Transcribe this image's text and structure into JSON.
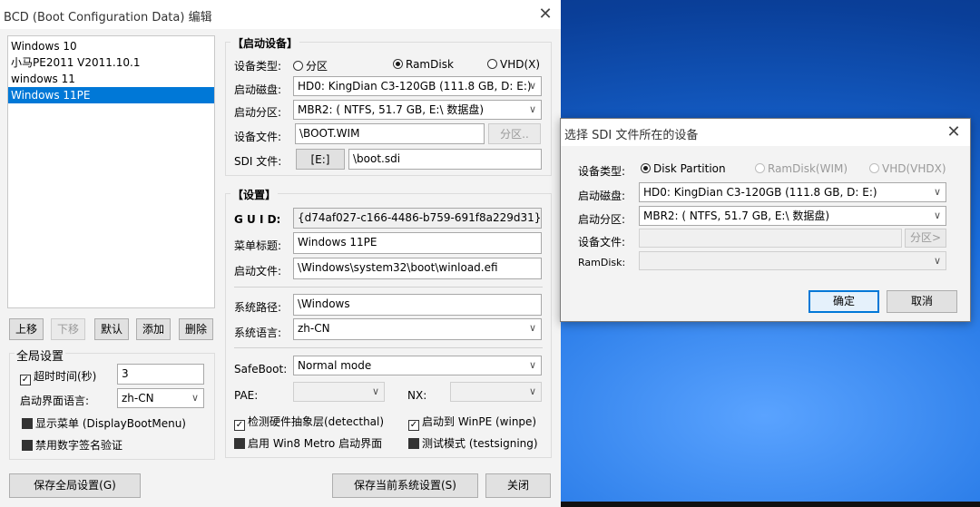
{
  "main_window": {
    "title": "BCD (Boot Configuration Data) 编辑",
    "close_glyph": "✕",
    "entries": [
      "Windows 10",
      "小马PE2011 V2011.10.1",
      "windows 11",
      "Windows 11PE"
    ],
    "list_buttons": {
      "up": "上移",
      "down": "下移",
      "default": "默认",
      "add": "添加",
      "delete": "删除"
    },
    "global_settings": {
      "title": "全局设置",
      "timeout_label": "超时时间(秒)",
      "timeout_value": "3",
      "boot_lang_label": "启动界面语言:",
      "boot_lang_value": "zh-CN",
      "show_menu_label": "显示菜单 (DisplayBootMenu)",
      "disable_sig_label": "禁用数字签名验证"
    },
    "boot_device": {
      "title": "【启动设备】",
      "type_label": "设备类型:",
      "type_partition": "分区",
      "type_ramdisk": "RamDisk",
      "type_vhd": "VHD(X)",
      "boot_disk_label": "启动磁盘:",
      "boot_disk_value": "HD0: KingDian C3-120GB (111.8 GB, D: E:)",
      "boot_part_label": "启动分区:",
      "boot_part_value": "MBR2: ( NTFS,  51.7 GB, E:\\ 数据盘)",
      "device_file_label": "设备文件:",
      "device_file_value": "\\BOOT.WIM",
      "partition_button": "分区..",
      "sdi_label": "SDI 文件:",
      "sdi_drive": "[E:]",
      "sdi_file": "\\boot.sdi"
    },
    "settings": {
      "title": "【设置】",
      "guid_label": "G U I D:",
      "guid_value": "{d74af027-c166-4486-b759-691f8a229d31}",
      "menu_title_label": "菜单标题:",
      "menu_title_value": "Windows 11PE",
      "boot_file_label": "启动文件:",
      "boot_file_value": "\\Windows\\system32\\boot\\winload.efi",
      "sys_path_label": "系统路径:",
      "sys_path_value": "\\Windows",
      "sys_lang_label": "系统语言:",
      "sys_lang_value": "zh-CN",
      "safeboot_label": "SafeBoot:",
      "safeboot_value": "Normal mode",
      "pae_label": "PAE:",
      "nx_label": "NX:",
      "detecthal_label": "检测硬件抽象层(detecthal)",
      "winpe_label": "启动到 WinPE (winpe)",
      "metro_label": "启用 Win8 Metro 启动界面",
      "testsigning_label": "测试模式 (testsigning)"
    },
    "bottom_buttons": {
      "save_global": "保存全局设置(G)",
      "save_current": "保存当前系统设置(S)",
      "close": "关闭"
    }
  },
  "sdi_dialog": {
    "title": "选择 SDI 文件所在的设备",
    "close_glyph": "✕",
    "type_label": "设备类型:",
    "type_partition": "Disk Partition",
    "type_ramdisk": "RamDisk(WIM)",
    "type_vhd": "VHD(VHDX)",
    "boot_disk_label": "启动磁盘:",
    "boot_disk_value": "HD0: KingDian C3-120GB (111.8 GB, D: E:)",
    "boot_part_label": "启动分区:",
    "boot_part_value": "MBR2: ( NTFS,  51.7 GB, E:\\ 数据盘)",
    "device_file_label": "设备文件:",
    "partition_button": "分区>",
    "ramdisk_label": "RamDisk:",
    "ok_button": "确定",
    "cancel_button": "取消"
  }
}
